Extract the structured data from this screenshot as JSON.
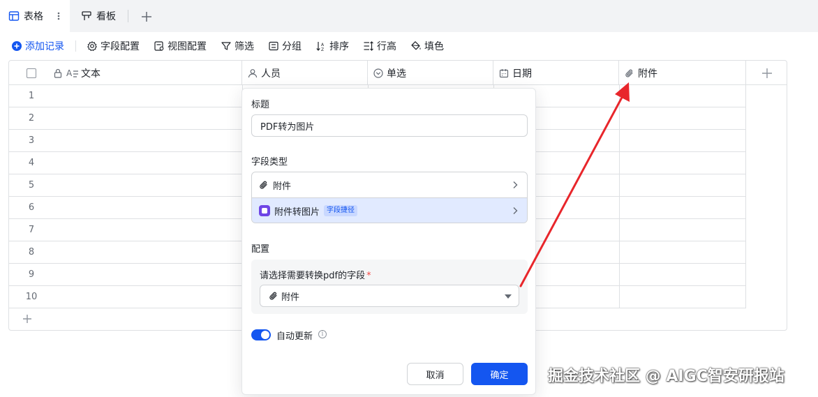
{
  "tabs": {
    "active_label": "表格",
    "board_label": "看板"
  },
  "toolbar": {
    "add_record": "添加记录",
    "field_config": "字段配置",
    "view_config": "视图配置",
    "filter": "筛选",
    "group": "分组",
    "sort": "排序",
    "row_height": "行高",
    "fill_color": "填色"
  },
  "grid": {
    "columns": [
      {
        "label": "文本",
        "icon": "text-icon"
      },
      {
        "label": "人员",
        "icon": "person-icon"
      },
      {
        "label": "单选",
        "icon": "single-select-icon"
      },
      {
        "label": "日期",
        "icon": "calendar-icon"
      },
      {
        "label": "附件",
        "icon": "paperclip-icon"
      }
    ],
    "row_numbers": [
      "1",
      "2",
      "3",
      "4",
      "5",
      "6",
      "7",
      "8",
      "9",
      "10"
    ]
  },
  "panel": {
    "title_label": "标题",
    "title_value": "PDF转为图片",
    "field_type_label": "字段类型",
    "field_type_base": "附件",
    "field_type_plugin": "附件转图片",
    "plugin_badge": "字段捷径",
    "config_label": "配置",
    "source_field_prompt": "请选择需要转换pdf的字段",
    "required_mark": "*",
    "source_field_value": "附件",
    "auto_update_label": "自动更新",
    "auto_update_on": true,
    "cancel_label": "取消",
    "confirm_label": "确定"
  },
  "watermark": "掘金技术社区 @ AIGC智安研报站",
  "colors": {
    "accent": "#1456f0",
    "annotation_arrow": "#e8262b",
    "plugin_icon": "#6e45e6"
  }
}
